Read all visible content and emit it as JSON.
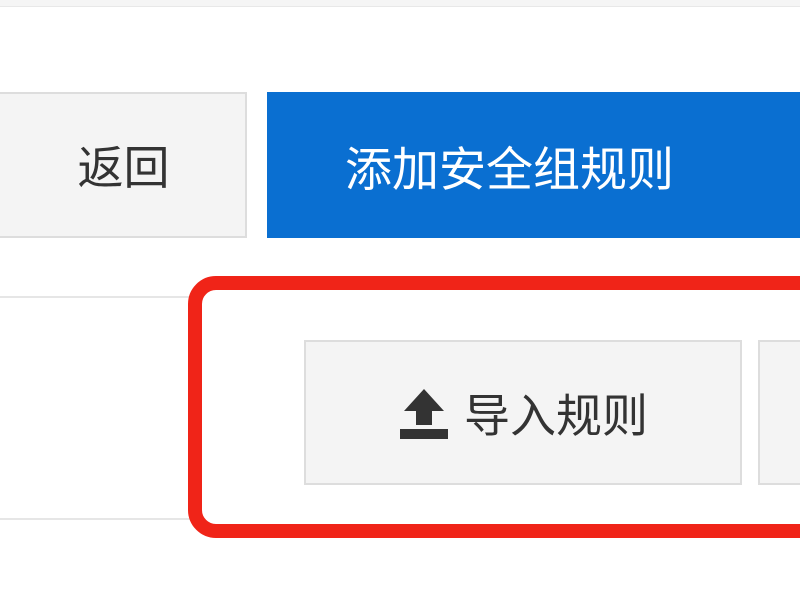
{
  "toolbar": {
    "back_label": "返回",
    "add_rule_label": "添加安全组规则"
  },
  "actions": {
    "import_label": "导入规则",
    "import_icon": "upload-icon"
  },
  "colors": {
    "primary": "#0a6fd1",
    "highlight": "#f02418",
    "button_bg": "#f4f4f4",
    "text": "#333333"
  }
}
